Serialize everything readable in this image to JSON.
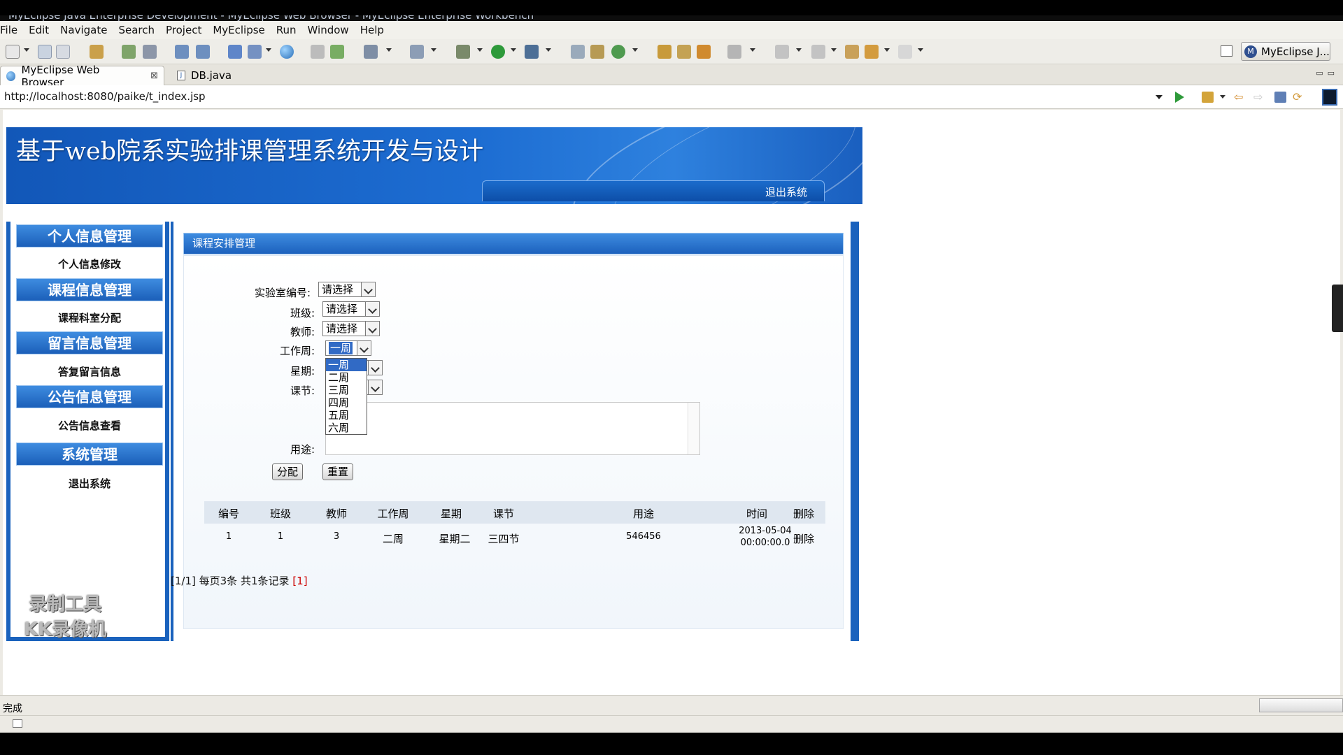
{
  "window": {
    "title": "MyEclipse Java Enterprise Development - MyEclipse Web Browser - MyEclipse Enterprise Workbench"
  },
  "menu": [
    "File",
    "Edit",
    "Navigate",
    "Search",
    "Project",
    "MyEclipse",
    "Run",
    "Window",
    "Help"
  ],
  "perspective": {
    "label": "MyEclipse J...",
    "badge": "M"
  },
  "editor_tabs": [
    {
      "label": "MyEclipse Web Browser",
      "close": "⊠"
    },
    {
      "label": "DB.java"
    }
  ],
  "address": {
    "url": "http://localhost:8080/paike/t_index.jsp"
  },
  "page": {
    "banner_title": "基于web院系实验排课管理系统开发与设计",
    "logout_top": "退出系统",
    "sidebar": [
      {
        "header": "个人信息管理",
        "item": "个人信息修改"
      },
      {
        "header": "课程信息管理",
        "item": "课程科室分配"
      },
      {
        "header": "留言信息管理",
        "item": "答复留言信息"
      },
      {
        "header": "公告信息管理",
        "item": "公告信息查看"
      },
      {
        "header": "系统管理",
        "item": "退出系统"
      }
    ],
    "watermark": [
      "录制工具",
      "KK录像机"
    ],
    "content_header": "课程安排管理",
    "form": {
      "lab_label": "实验室编号:",
      "lab_value": "请选择",
      "class_label": "班级:",
      "class_value": "请选择",
      "teacher_label": "教师:",
      "teacher_value": "请选择",
      "week_label": "工作周:",
      "week_value": "一周",
      "weekday_label": "星期:",
      "period_label": "课节:",
      "purpose_label": "用途:",
      "week_options": [
        "一周",
        "二周",
        "三周",
        "四周",
        "五周",
        "六周"
      ],
      "assign_button": "分配",
      "reset_button": "重置"
    },
    "table": {
      "headers": [
        "编号",
        "班级",
        "教师",
        "工作周",
        "星期",
        "课节",
        "用途",
        "时间",
        "删除"
      ],
      "rows": [
        {
          "id": "1",
          "class": "1",
          "teacher": "3",
          "week": "二周",
          "weekday": "星期二",
          "period": "三四节",
          "purpose": "546456",
          "time_line1": "2013-05-04",
          "time_line2": "00:00:00.0",
          "delete": "删除"
        }
      ]
    },
    "pager": {
      "position": "[1/1]",
      "per_page": "每页3条",
      "total": "共1条记录",
      "page_link": "[1]"
    }
  },
  "status": {
    "text": "完成"
  },
  "colors": {
    "accent": "#1a62bd",
    "header_gradient_top": "#3e8ce0",
    "pager_link": "#cc0000",
    "selection": "#316ac5"
  }
}
